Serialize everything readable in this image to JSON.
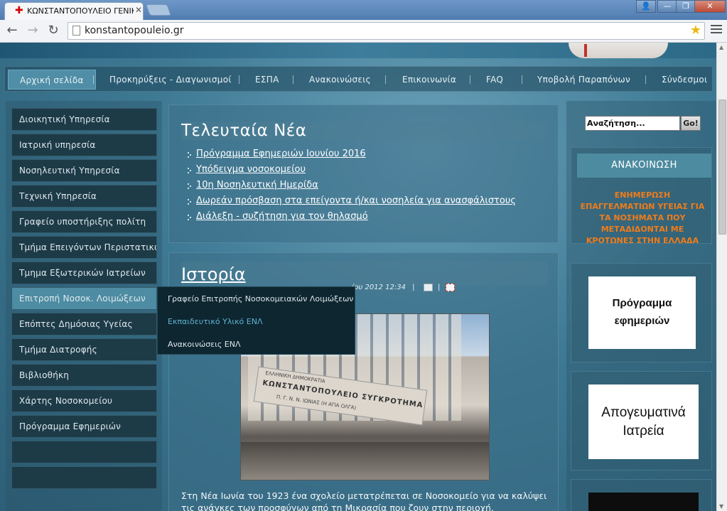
{
  "browser": {
    "tab_title": "ΚΩΝΣΤΑΝΤΟΠΟΥΛΕΙΟ ΓΕΝΙΚ",
    "tab_close": "✕",
    "url": "konstantopouleio.gr",
    "win_user": "👤",
    "win_min": "—",
    "win_max": "❐",
    "win_close": "✕"
  },
  "nav": {
    "items": [
      "Αρχική σελίδα",
      "Προκηρύξεις - Διαγωνισμοί",
      "ΕΣΠΑ",
      "Ανακοινώσεις",
      "Επικοινωνία",
      "FAQ",
      "Υποβολή Παραπόνων",
      "Σύνδεσμοι"
    ]
  },
  "sidebar": {
    "items": [
      "Διοικητική Υπηρεσία",
      "Ιατρική υπηρεσία",
      "Νοσηλευτική Υπηρεσία",
      "Τεχνική Υπηρεσία",
      "Γραφείο υποστήριξης πολίτη",
      "Τμήμα Επειγόντων Περιστατικών",
      "Τμημα Εξωτερικών Ιατρείων",
      "Επιτροπή Νοσοκ. Λοιμώξεων",
      "Επόπτες Δημόσιας Υγείας",
      "Τμήμα Διατροφής",
      "Βιβλιοθήκη",
      "Χάρτης Νοσοκομείου",
      "Πρόγραμμα Εφημεριών",
      "",
      ""
    ],
    "flyout": [
      "Γραφείο Επιτροπής Νοσοκομειακών Λοιμώξεων",
      "Εκπαιδευτικό Υλικό ΕΝΛ",
      "Ανακοινώσεις ΕΝΛ"
    ]
  },
  "news": {
    "title": "Τελευταία Νέα",
    "items": [
      "Πρόγραμμα Εφημεριών Ιουνίου 2016",
      "Υπόδειγμα νοσοκομείου",
      "10η Νοσηλευτική Ημερίδα",
      "Δωρεάν πρόσβαση στα επείγοντα ή/και νοσηλεία για ανασφάλιστους",
      "Διάλεξη - συζήτηση για τον θηλασμό"
    ]
  },
  "article": {
    "title": "Ιστορία",
    "meta": "ίου 2012 12:34",
    "meta_sep1": "|",
    "meta_sep2": "|",
    "photo_sign": "ΚΩΝΣΤΑΝΤΟΠΟΥΛΕΙΟ ΣΥΓΚΡΟΤΗΜΑ",
    "photo_sign_top": "ΕΛΛΗΝΙΚΗ ΔΗΜΟΚΡΑΤΙΑ",
    "photo_sign_bottom": "Π. Γ. Ν. Ν. ΙΩΝΙΑΣ (Η ΑΓΙΑ ΟΛΓΑ)",
    "text": "Στη Νέα Ιωνία του 1923 ένα σχολείο μετατρέπεται σε Νοσοκομείο για να καλύψει τις ανάγκες των προσφύγων από τη Μικρασία που ζουν στην περιοχή."
  },
  "right": {
    "search_value": "Αναζήτηση...",
    "go_label": "Go!",
    "announcement_heading": "ΑΝΑΚΟΙΝΩΣΗ",
    "announcement_text": "ΕΝΗΜΕΡΩΣΗ ΕΠΑΓΓΕΛΜΑΤΙΩΝ ΥΓΕΙΑΣ ΓΙΑ ΤΑ ΝΟΣΗΜΑΤΑ ΠΟΥ ΜΕΤΑΔΙΔΟΝΤΑΙ ΜΕ ΚΡΟΤΩΝΕΣ ΣΤΗΝ ΕΛΛΑΔΑ",
    "card1_line1": "Πρόγραμμα",
    "card1_line2": "εφημεριών",
    "card2_line1": "Απογευματινά",
    "card2_line2": "Ιατρεία"
  },
  "colors": {
    "accent": "#4f8ea6",
    "announcement_text": "#f07c1a",
    "flyout_highlight": "#5fb3d3"
  }
}
